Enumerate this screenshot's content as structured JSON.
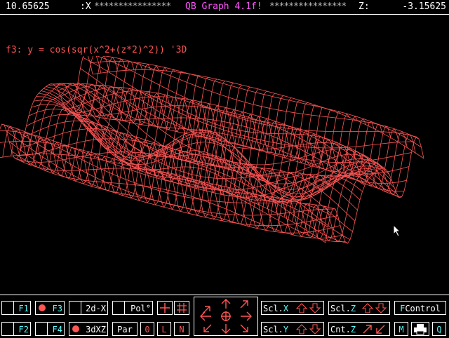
{
  "header": {
    "x_value": "10.65625",
    "x_label": ":X",
    "stars": "****************",
    "title": "QB Graph 4.1f!",
    "z_label": "Z:",
    "z_value": "-3.15625"
  },
  "formula": "f3: y = cos(sqr(x^2+(z*2)^2)) '3D",
  "colors": {
    "plot": "#ff5555",
    "accent": "#55ffff",
    "title": "#ff55ff"
  },
  "toolbar": {
    "f1": "F1",
    "f2": "F2",
    "f3": "F3",
    "f4": "F4",
    "mode_2d": "2d-X",
    "mode_3d": "3dXZ",
    "polar": "Pol°",
    "par": "Par",
    "zero": "0",
    "l": "L",
    "n": "N",
    "scl_x_prefix": "Scl.",
    "scl_x_axis": "X",
    "scl_y_prefix": "Scl.",
    "scl_y_axis": "Y",
    "scl_z_prefix": "Scl.",
    "scl_z_axis": "Z",
    "cnt_z_prefix": "Cnt.",
    "cnt_z_axis": "Z",
    "fcontrol_f": "F",
    "fcontrol_rest": "Control",
    "m": "M",
    "q": "Q"
  },
  "icons": [
    "crosshair-icon",
    "grid-icon",
    "arrow-up-left-icon",
    "arrow-up-icon",
    "arrow-up-right-icon",
    "arrow-left-icon",
    "center-target-icon",
    "arrow-right-icon",
    "arrow-down-left-icon",
    "arrow-down-icon",
    "arrow-down-right-icon",
    "arrow-up-icon",
    "arrow-down-icon",
    "printer-icon"
  ]
}
